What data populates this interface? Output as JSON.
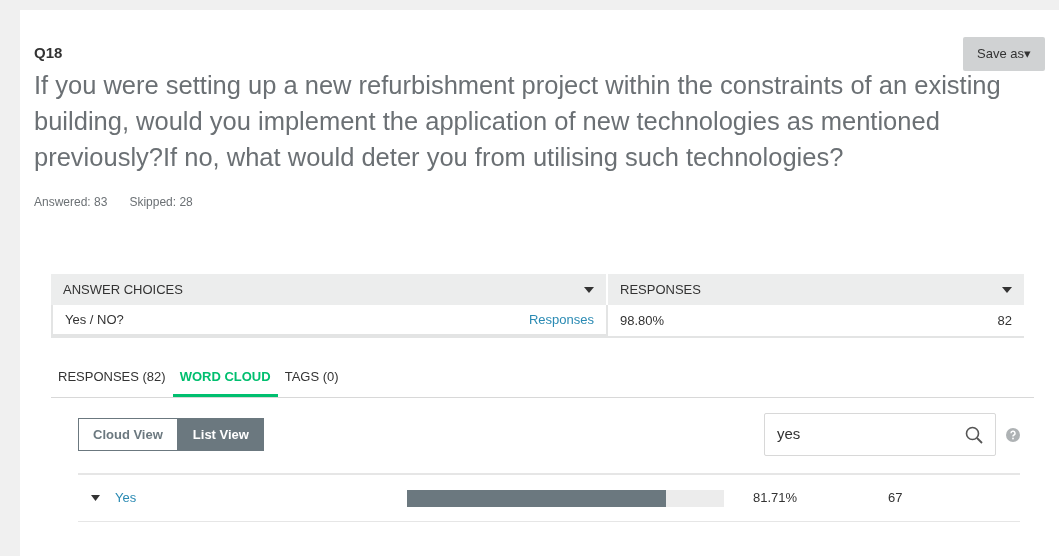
{
  "question": {
    "number": "Q18",
    "text": "If you were setting up a new refurbishment project within the constraints of an existing building, would you implement the application of new technologies as mentioned previously?If no, what would deter you from utilising such technologies?",
    "answered": "Answered: 83",
    "skipped": "Skipped: 28"
  },
  "save_button": {
    "label": "Save as▾"
  },
  "table": {
    "columns": [
      "ANSWER CHOICES",
      "RESPONSES"
    ],
    "rows": [
      {
        "choice": "Yes / NO?",
        "link": "Responses",
        "percent": "98.80%",
        "count": "82"
      }
    ]
  },
  "tabs": [
    {
      "label": "RESPONSES (82)",
      "selected": false
    },
    {
      "label": "WORD CLOUD",
      "selected": true
    },
    {
      "label": "TAGS (0)",
      "selected": false
    }
  ],
  "view_toggle": [
    {
      "label": "Cloud View",
      "selected": false
    },
    {
      "label": "List View",
      "selected": true
    }
  ],
  "search": {
    "value": "yes"
  },
  "words": [
    {
      "word": "Yes",
      "level": 0.817,
      "percent": "81.71%",
      "count": "67",
      "expanded": true
    }
  ]
}
